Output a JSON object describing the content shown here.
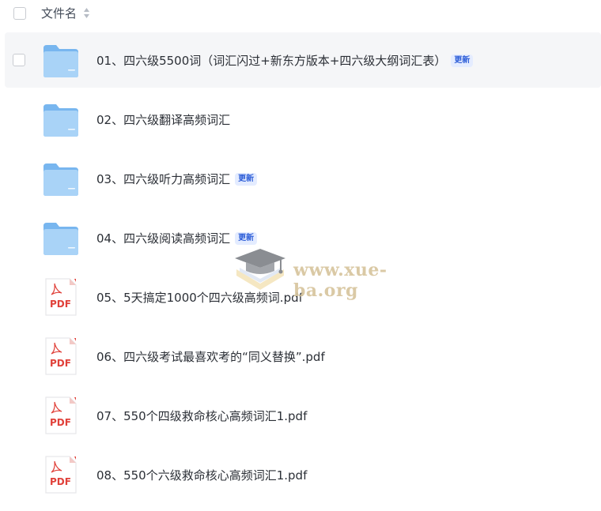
{
  "header": {
    "column_label": "文件名"
  },
  "files": [
    {
      "name": "01、四六级5500词（词汇闪过+新东方版本+四六级大纲词汇表）",
      "type": "folder",
      "badge": "更新",
      "selected": true
    },
    {
      "name": "02、四六级翻译高频词汇",
      "type": "folder",
      "badge": ""
    },
    {
      "name": "03、四六级听力高频词汇",
      "type": "folder",
      "badge": "更新"
    },
    {
      "name": "04、四六级阅读高频词汇",
      "type": "folder",
      "badge": "更新"
    },
    {
      "name": "05、5天搞定1000个四六级高频词.pdf",
      "type": "pdf",
      "badge": ""
    },
    {
      "name": "06、四六级考试最喜欢考的“同义替换”.pdf",
      "type": "pdf",
      "badge": ""
    },
    {
      "name": "07、550个四级救命核心高频词汇1.pdf",
      "type": "pdf",
      "badge": ""
    },
    {
      "name": "08、550个六级救命核心高频词汇1.pdf",
      "type": "pdf",
      "badge": ""
    }
  ],
  "pdf_icon_label": "PDF",
  "watermark": {
    "text": "www.xue-ba.org"
  },
  "icons": {
    "folder": "folder-icon",
    "pdf": "pdf-file-icon",
    "sort": "sort-icon",
    "watermark": "graduation-cap-icon"
  },
  "colors": {
    "folder_light": "#a9d3f7",
    "folder_dark": "#78b6ef",
    "pdf_red": "#e0413a",
    "badge_text": "#2f5fd8",
    "badge_bg": "#e4ecff",
    "selected_row_bg": "#f5f6f8"
  }
}
